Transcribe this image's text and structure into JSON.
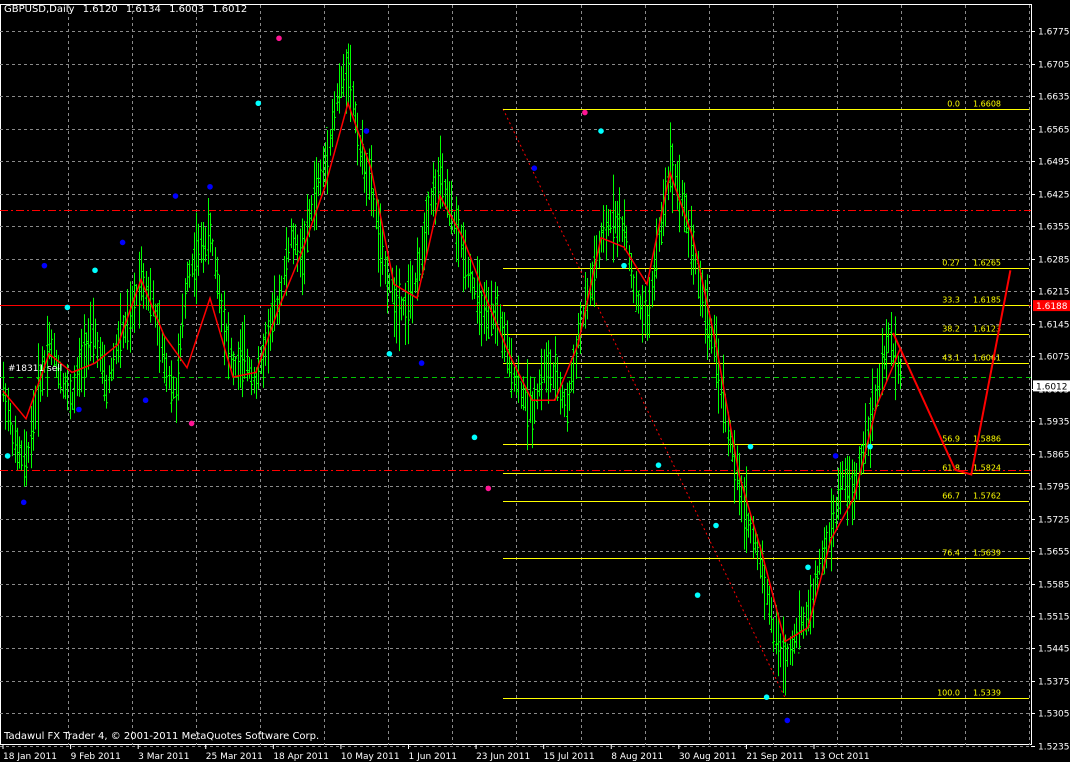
{
  "header": {
    "symbol": "GBPUSD,Daily",
    "open": "1.6120",
    "high": "1.6134",
    "low": "1.6003",
    "close": "1.6012"
  },
  "footer": "Tadawul FX Trader 4, © 2001-2011 MetaQuotes Software Corp.",
  "order_label": "#18311 sell",
  "colors": {
    "background": "#000000",
    "grid": "#8a8a8a",
    "candle": "#00ff00",
    "ma": "#ff0000",
    "fib": "#ffff00",
    "hline": "#ff0000",
    "projection": "#ff0000",
    "order_level": "#00c800",
    "price_box": "#ffffff",
    "marker_hi": "#00ffff",
    "marker_lo": "#0000ff",
    "marker_pivot": "#ff1493"
  },
  "chart_data": {
    "type": "line",
    "ylim": [
      1.5237,
      1.6808
    ],
    "yticks": [
      "1.6775",
      "1.6705",
      "1.6635",
      "1.6565",
      "1.6495",
      "1.6425",
      "1.6355",
      "1.6285",
      "1.6215",
      "1.6145",
      "1.6075",
      "1.6005",
      "1.5935",
      "1.5865",
      "1.5795",
      "1.5725",
      "1.5655",
      "1.5585",
      "1.5515",
      "1.5445",
      "1.5375",
      "1.5305",
      "1.5235"
    ],
    "xticks": [
      "18 Jan 2011",
      "9 Feb 2011",
      "3 Mar 2011",
      "25 Mar 2011",
      "18 Apr 2011",
      "10 May 2011",
      "1 Jun 2011",
      "23 Jun 2011",
      "15 Jul 2011",
      "8 Aug 2011",
      "30 Aug 2011",
      "21 Sep 2011",
      "13 Oct 2011"
    ],
    "price_path": [
      [
        0,
        1.601
      ],
      [
        5,
        1.588
      ],
      [
        10,
        1.584
      ],
      [
        15,
        1.6
      ],
      [
        20,
        1.611
      ],
      [
        25,
        1.603
      ],
      [
        30,
        1.598
      ],
      [
        35,
        1.609
      ],
      [
        40,
        1.612
      ],
      [
        45,
        1.6
      ],
      [
        50,
        1.611
      ],
      [
        55,
        1.615
      ],
      [
        60,
        1.625
      ],
      [
        65,
        1.619
      ],
      [
        70,
        1.606
      ],
      [
        75,
        1.599
      ],
      [
        80,
        1.625
      ],
      [
        85,
        1.63
      ],
      [
        90,
        1.634
      ],
      [
        95,
        1.618
      ],
      [
        100,
        1.605
      ],
      [
        105,
        1.607
      ],
      [
        110,
        1.602
      ],
      [
        115,
        1.612
      ],
      [
        120,
        1.62
      ],
      [
        125,
        1.633
      ],
      [
        130,
        1.629
      ],
      [
        135,
        1.642
      ],
      [
        140,
        1.649
      ],
      [
        145,
        1.663
      ],
      [
        150,
        1.67
      ],
      [
        155,
        1.652
      ],
      [
        160,
        1.644
      ],
      [
        165,
        1.628
      ],
      [
        170,
        1.62
      ],
      [
        175,
        1.618
      ],
      [
        180,
        1.624
      ],
      [
        185,
        1.64
      ],
      [
        190,
        1.646
      ],
      [
        195,
        1.638
      ],
      [
        200,
        1.63
      ],
      [
        205,
        1.622
      ],
      [
        210,
        1.615
      ],
      [
        215,
        1.617
      ],
      [
        220,
        1.606
      ],
      [
        225,
        1.6
      ],
      [
        230,
        1.596
      ],
      [
        235,
        1.605
      ],
      [
        240,
        1.603
      ],
      [
        245,
        1.596
      ],
      [
        250,
        1.612
      ],
      [
        255,
        1.622
      ],
      [
        260,
        1.632
      ],
      [
        265,
        1.638
      ],
      [
        270,
        1.635
      ],
      [
        275,
        1.62
      ],
      [
        280,
        1.615
      ],
      [
        285,
        1.633
      ],
      [
        290,
        1.649
      ],
      [
        295,
        1.642
      ],
      [
        300,
        1.63
      ],
      [
        305,
        1.618
      ],
      [
        310,
        1.607
      ],
      [
        315,
        1.592
      ],
      [
        320,
        1.579
      ],
      [
        325,
        1.57
      ],
      [
        330,
        1.562
      ],
      [
        335,
        1.548
      ],
      [
        340,
        1.542
      ],
      [
        345,
        1.548
      ],
      [
        350,
        1.552
      ],
      [
        355,
        1.562
      ],
      [
        360,
        1.57
      ],
      [
        365,
        1.581
      ],
      [
        370,
        1.578
      ],
      [
        375,
        1.59
      ],
      [
        380,
        1.6
      ],
      [
        385,
        1.611
      ],
      [
        390,
        1.604
      ]
    ],
    "ma_path": [
      [
        0,
        1.6
      ],
      [
        10,
        1.594
      ],
      [
        20,
        1.608
      ],
      [
        30,
        1.604
      ],
      [
        40,
        1.606
      ],
      [
        50,
        1.61
      ],
      [
        60,
        1.624
      ],
      [
        70,
        1.612
      ],
      [
        80,
        1.605
      ],
      [
        90,
        1.62
      ],
      [
        100,
        1.603
      ],
      [
        110,
        1.604
      ],
      [
        120,
        1.618
      ],
      [
        130,
        1.63
      ],
      [
        140,
        1.644
      ],
      [
        150,
        1.662
      ],
      [
        160,
        1.648
      ],
      [
        170,
        1.623
      ],
      [
        180,
        1.62
      ],
      [
        190,
        1.642
      ],
      [
        200,
        1.633
      ],
      [
        210,
        1.62
      ],
      [
        220,
        1.608
      ],
      [
        230,
        1.598
      ],
      [
        240,
        1.598
      ],
      [
        250,
        1.61
      ],
      [
        260,
        1.633
      ],
      [
        270,
        1.631
      ],
      [
        280,
        1.623
      ],
      [
        290,
        1.647
      ],
      [
        300,
        1.633
      ],
      [
        310,
        1.61
      ],
      [
        320,
        1.582
      ],
      [
        330,
        1.565
      ],
      [
        340,
        1.546
      ],
      [
        350,
        1.549
      ],
      [
        360,
        1.568
      ],
      [
        370,
        1.577
      ],
      [
        380,
        1.597
      ],
      [
        390,
        1.609
      ]
    ],
    "markers": [
      {
        "x": 2,
        "y": 1.586,
        "kind": "hi"
      },
      {
        "x": 9,
        "y": 1.576,
        "kind": "lo"
      },
      {
        "x": 18,
        "y": 1.627,
        "kind": "lo"
      },
      {
        "x": 28,
        "y": 1.618,
        "kind": "hi"
      },
      {
        "x": 33,
        "y": 1.596,
        "kind": "lo"
      },
      {
        "x": 40,
        "y": 1.626,
        "kind": "hi"
      },
      {
        "x": 52,
        "y": 1.632,
        "kind": "lo"
      },
      {
        "x": 62,
        "y": 1.598,
        "kind": "lo"
      },
      {
        "x": 75,
        "y": 1.642,
        "kind": "lo"
      },
      {
        "x": 82,
        "y": 1.593,
        "kind": "pivot"
      },
      {
        "x": 90,
        "y": 1.644,
        "kind": "lo"
      },
      {
        "x": 111,
        "y": 1.662,
        "kind": "hi"
      },
      {
        "x": 120,
        "y": 1.676,
        "kind": "pivot"
      },
      {
        "x": 158,
        "y": 1.656,
        "kind": "lo"
      },
      {
        "x": 168,
        "y": 1.608,
        "kind": "hi"
      },
      {
        "x": 182,
        "y": 1.606,
        "kind": "lo"
      },
      {
        "x": 205,
        "y": 1.59,
        "kind": "hi"
      },
      {
        "x": 211,
        "y": 1.579,
        "kind": "pivot"
      },
      {
        "x": 231,
        "y": 1.648,
        "kind": "lo"
      },
      {
        "x": 253,
        "y": 1.66,
        "kind": "pivot"
      },
      {
        "x": 260,
        "y": 1.656,
        "kind": "hi"
      },
      {
        "x": 270,
        "y": 1.627,
        "kind": "hi"
      },
      {
        "x": 285,
        "y": 1.584,
        "kind": "hi"
      },
      {
        "x": 302,
        "y": 1.556,
        "kind": "hi"
      },
      {
        "x": 310,
        "y": 1.571,
        "kind": "hi"
      },
      {
        "x": 325,
        "y": 1.588,
        "kind": "hi"
      },
      {
        "x": 332,
        "y": 1.534,
        "kind": "hi"
      },
      {
        "x": 341,
        "y": 1.529,
        "kind": "lo"
      },
      {
        "x": 350,
        "y": 1.562,
        "kind": "hi"
      },
      {
        "x": 362,
        "y": 1.586,
        "kind": "lo"
      },
      {
        "x": 377,
        "y": 1.588,
        "kind": "hi"
      }
    ],
    "fib_levels": [
      {
        "ratio": "0.0",
        "price": "1.6608",
        "value": 1.6608
      },
      {
        "ratio": "0.27",
        "price": "1.6265",
        "value": 1.6265
      },
      {
        "ratio": "33.3",
        "price": "1.6185",
        "value": 1.6185
      },
      {
        "ratio": "38.2",
        "price": "1.6123",
        "value": 1.6123
      },
      {
        "ratio": "43.1",
        "price": "1.6061",
        "value": 1.6061
      },
      {
        "ratio": "56.9",
        "price": "1.5886",
        "value": 1.5886
      },
      {
        "ratio": "61.8",
        "price": "1.5824",
        "value": 1.5824
      },
      {
        "ratio": "66.7",
        "price": "1.5762",
        "value": 1.5762
      },
      {
        "ratio": "76.4",
        "price": "1.5639",
        "value": 1.5639
      },
      {
        "ratio": "100.0",
        "price": "1.5339",
        "value": 1.5339
      }
    ],
    "hlines": [
      {
        "value": 1.6185,
        "style": "solid",
        "label": "1.6188"
      },
      {
        "value": 1.639,
        "style": "dashdot"
      },
      {
        "value": 1.583,
        "style": "dashdot"
      }
    ],
    "order_level": 1.603,
    "current_price": {
      "value": 1.6012,
      "label": "1.6012"
    },
    "projection": [
      [
        387,
        1.6125
      ],
      [
        414,
        1.583
      ],
      [
        421,
        1.582
      ],
      [
        438,
        1.626
      ]
    ]
  }
}
